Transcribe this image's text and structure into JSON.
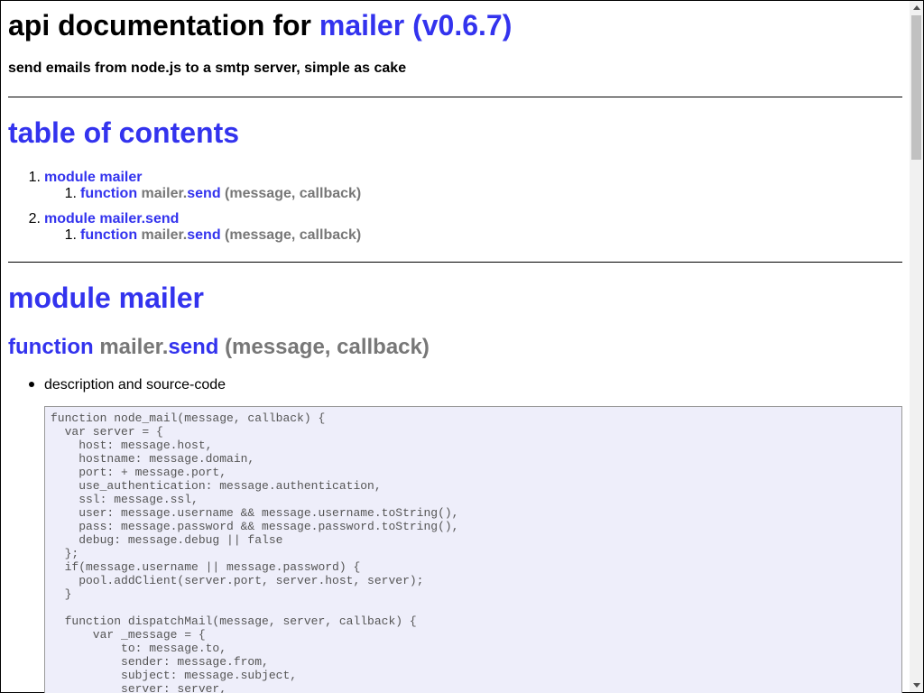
{
  "header": {
    "title_prefix": "api documentation for ",
    "title_link": "mailer (v0.6.7)",
    "subtitle": "send emails from node.js to a smtp server, simple as cake"
  },
  "toc": {
    "heading": "table of contents",
    "items": [
      {
        "number": "1.",
        "label": "module mailer",
        "sub": {
          "number": "1.",
          "keyword": "function",
          "object": "mailer.",
          "method": "send",
          "args": "(message, callback)"
        }
      },
      {
        "number": "2.",
        "label": "module mailer.send",
        "sub": {
          "number": "1.",
          "keyword": "function",
          "object": "mailer.",
          "method": "send",
          "args": "(message, callback)"
        }
      }
    ]
  },
  "module_section": {
    "heading": "module mailer",
    "function_heading": {
      "keyword": "function",
      "object": "mailer.",
      "method": "send",
      "args": "(message, callback)"
    },
    "bullet": "description and source-code",
    "code": "function node_mail(message, callback) {\n  var server = {\n    host: message.host,\n    hostname: message.domain,\n    port: + message.port,\n    use_authentication: message.authentication,\n    ssl: message.ssl,\n    user: message.username && message.username.toString(),\n    pass: message.password && message.password.toString(),\n    debug: message.debug || false\n  };\n  if(message.username || message.password) {\n    pool.addClient(server.port, server.host, server);\n  }\n\n  function dispatchMail(message, server, callback) {\n      var _message = {\n          to: message.to,\n          sender: message.from,\n          subject: message.subject,\n          server: server,"
  },
  "colors": {
    "link": "#3333ee",
    "muted": "#777777",
    "code_bg": "#eeeefa"
  }
}
